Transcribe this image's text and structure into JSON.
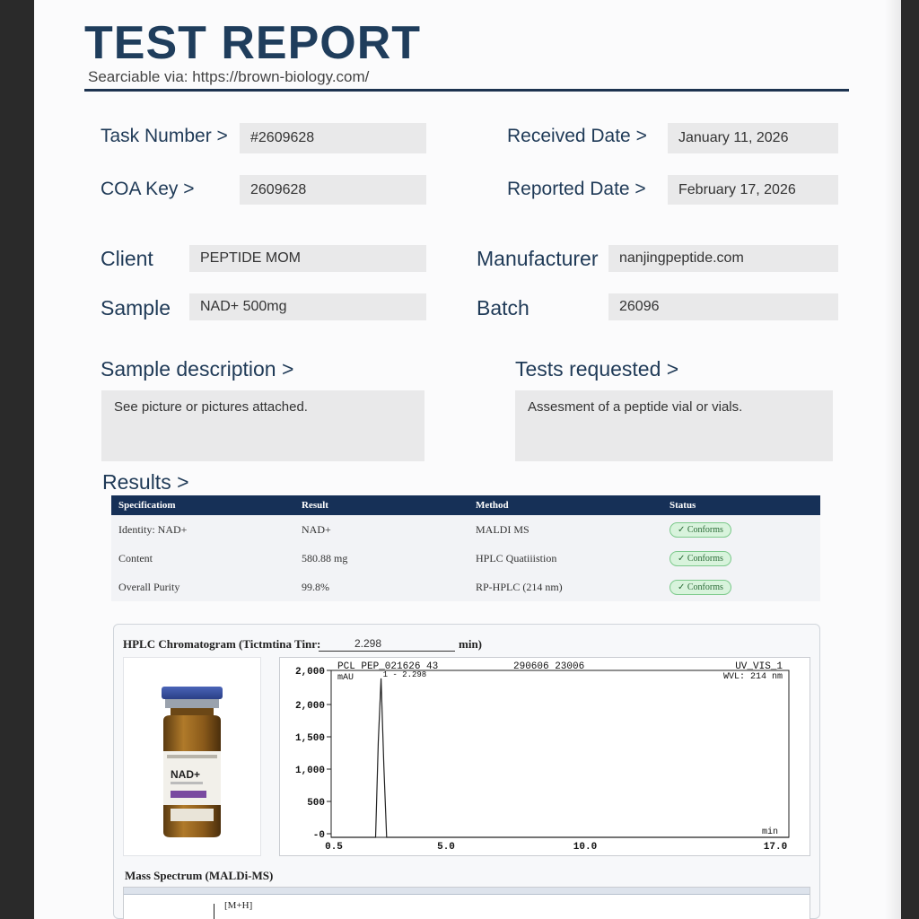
{
  "header": {
    "title": "TEST REPORT",
    "searchable": "Searciable via: https://brown-biology.com/"
  },
  "fields": {
    "task_number_label": "Task Number  >",
    "task_number": "#2609628",
    "received_date_label": "Received Date  >",
    "received_date": "January 11, 2026",
    "coa_key_label": "COA  Key >",
    "coa_key": "2609628",
    "reported_date_label": "Reported Date >",
    "reported_date": "February 17, 2026",
    "client_label": "Client",
    "client": "PEPTIDE MOM",
    "manufacturer_label": "Manufacturer",
    "manufacturer": "nanjingpeptide.com",
    "sample_label": "Sample",
    "sample": "NAD+ 500mg",
    "batch_label": "Batch",
    "batch": "26096"
  },
  "sample_description": {
    "label": "Sample description   >",
    "text": "See picture or pictures attached."
  },
  "tests_requested": {
    "label": "Tests requested   >",
    "text": "Assesment of a peptide vial or vials."
  },
  "results": {
    "label": "Results   >",
    "columns": [
      "Specificatiom",
      "Result",
      "Method",
      "Status"
    ],
    "rows": [
      {
        "spec": "Identity:  NAD+",
        "result": "NAD+",
        "method": "MALDI MS",
        "status": "✓ Conforms"
      },
      {
        "spec": "Content",
        "result": "580.88  mg",
        "method": "HPLC Quatiiistion",
        "status": "✓ Conforms"
      },
      {
        "spec": "Overall Purity",
        "result": "99.8%",
        "method": "RP-HPLC (214 nm)",
        "status": "✓ Conforms"
      }
    ]
  },
  "hplc": {
    "title": "HPLC Chromatogram (Tictmtina Tinr:",
    "retention_value": "2.298",
    "retention_unit": "min)",
    "vial_label": "NAD+",
    "chart_header_left": "PCL PEP_021626 43",
    "chart_header_mid": "290606 23006",
    "chart_header_right1": "UV_VIS_1",
    "chart_header_right2": "WVL: 214 nm",
    "peak_label": "1 - 2.298"
  },
  "chart_data": {
    "type": "line",
    "title": "",
    "xlabel": "min",
    "ylabel": "mAU",
    "xlim": [
      0.5,
      17.0
    ],
    "ylim": [
      0,
      2100
    ],
    "x_ticks": [
      "0.5",
      "5.0",
      "10.0",
      "17.0"
    ],
    "y_ticks": [
      "-0",
      "500",
      "1,000",
      "1,500",
      "2,000",
      "2,000"
    ],
    "series": [
      {
        "x": [
          0.5,
          2.1,
          2.2,
          2.298,
          2.4,
          2.5,
          17.0
        ],
        "y": [
          0,
          0,
          1200,
          2000,
          900,
          0,
          0
        ]
      }
    ]
  },
  "ms": {
    "title": "Mass Spectrum (MALDi-MS)",
    "peak_label": "[M+H]"
  }
}
